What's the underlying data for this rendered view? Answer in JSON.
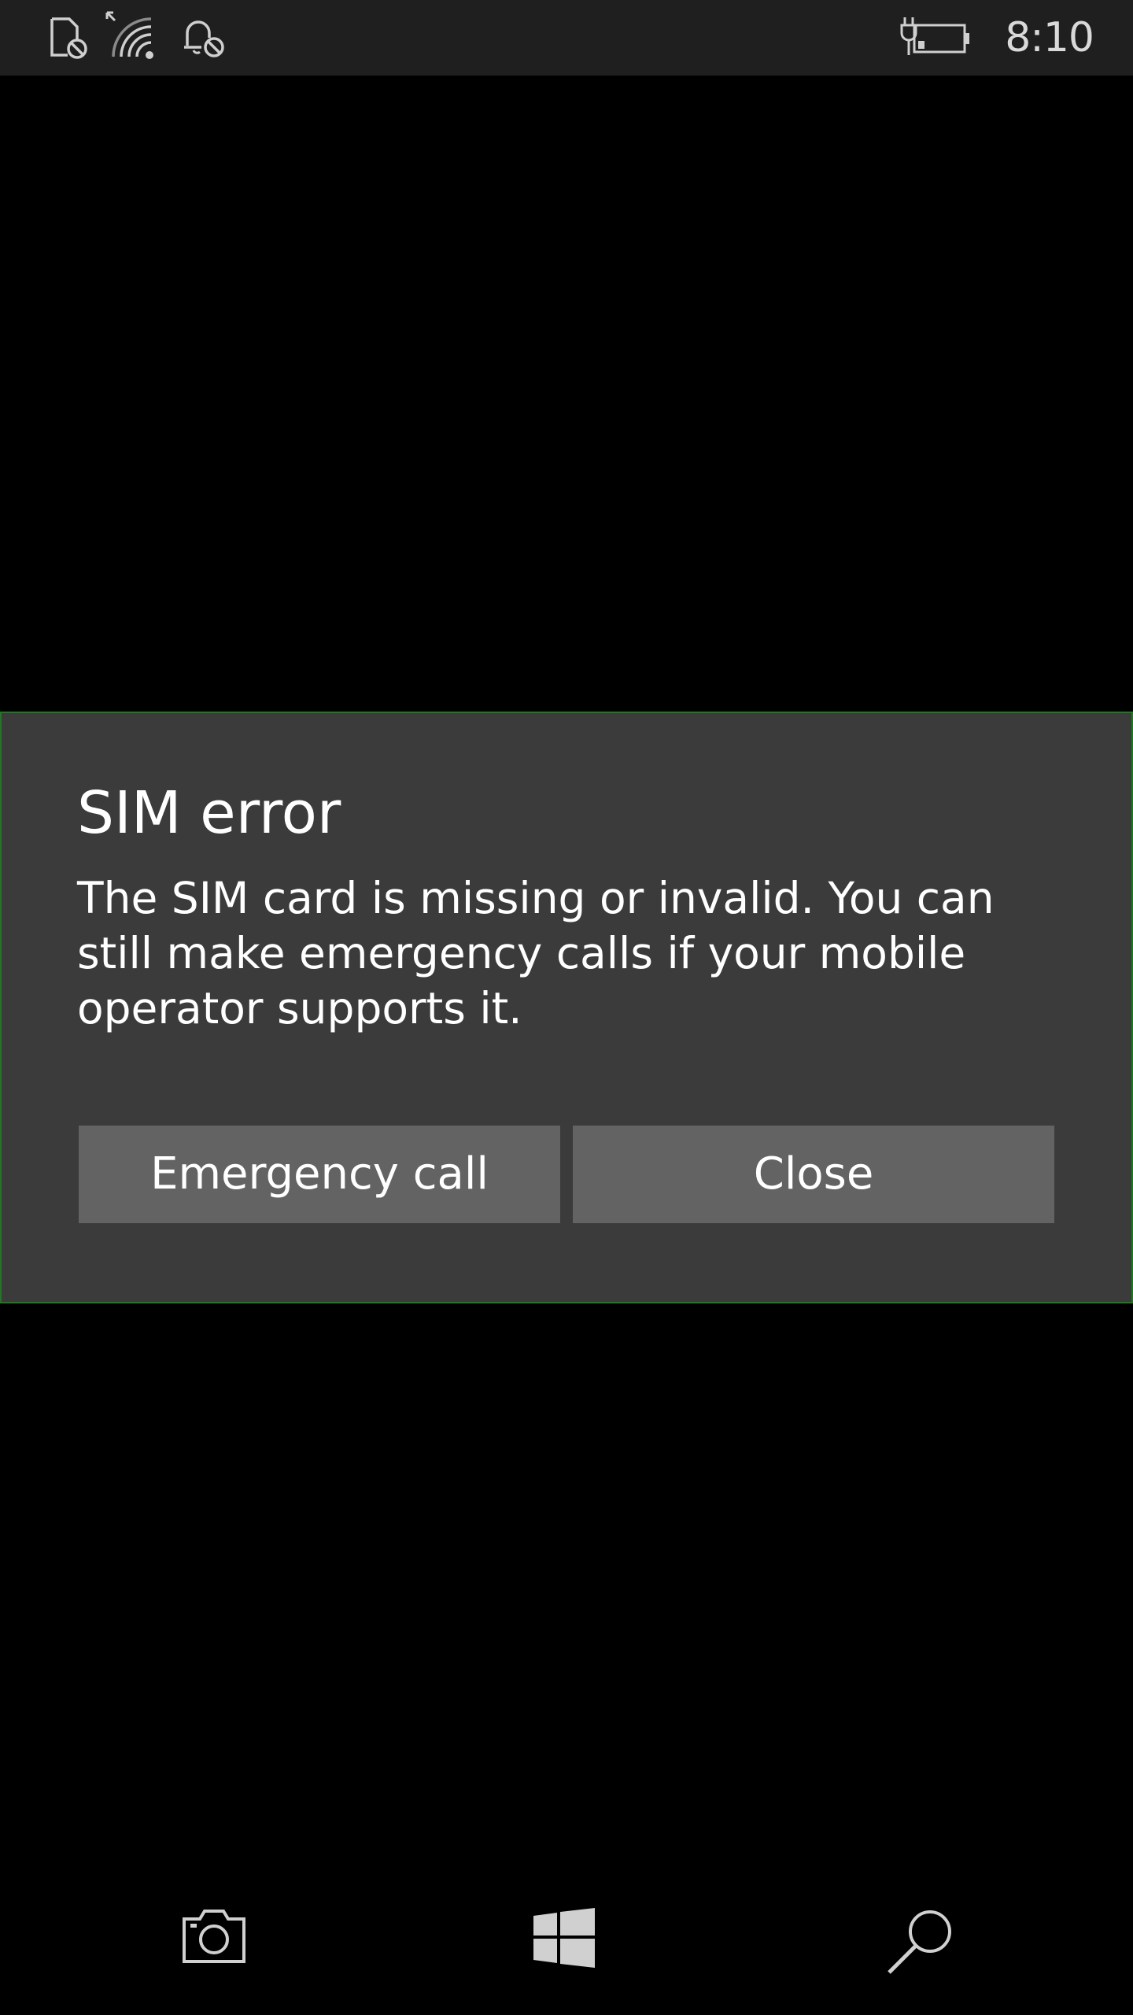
{
  "status_bar": {
    "icons": [
      "no-sim-icon",
      "wifi-signal-icon",
      "quiet-hours-icon",
      "battery-charging-icon"
    ],
    "time": "8:10"
  },
  "dialog": {
    "title": "SIM error",
    "message": "The SIM card is missing or invalid. You can still make emergency calls if your mobile operator supports it.",
    "buttons": {
      "emergency_label": "Emergency call",
      "close_label": "Close"
    }
  },
  "navigation": {
    "icons": [
      "camera-icon",
      "windows-start-icon",
      "search-icon"
    ]
  },
  "colors": {
    "background": "#000000",
    "status_bar_bg": "#1f1f1f",
    "dialog_bg": "#3b3b3b",
    "dialog_border": "#1e7a1e",
    "button_bg": "#636363",
    "text": "#ffffff"
  }
}
